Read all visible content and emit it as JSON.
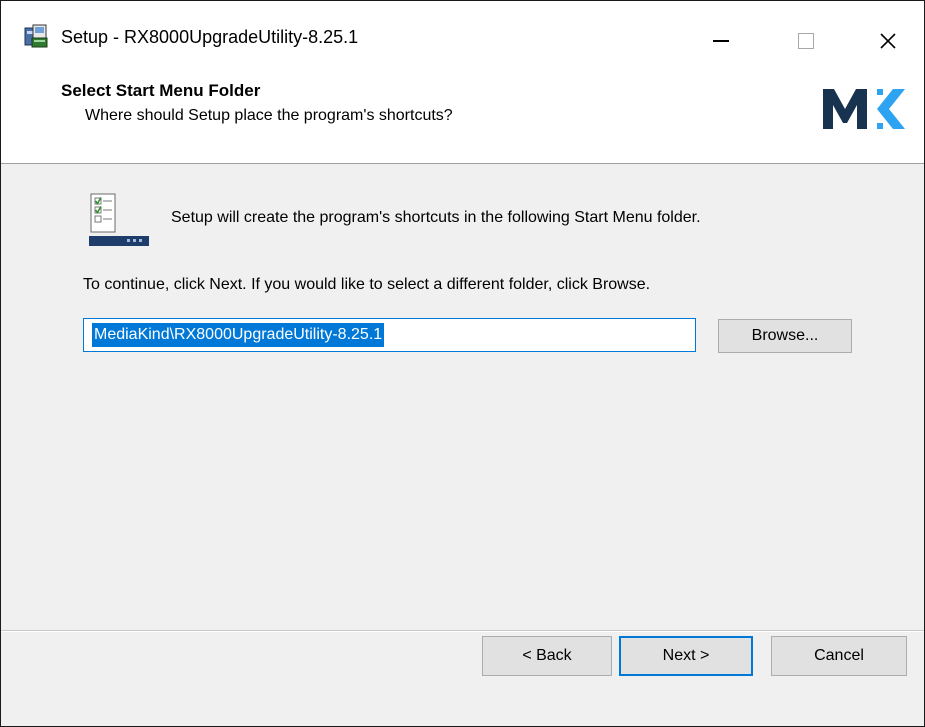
{
  "window": {
    "title": "Setup - RX8000UpgradeUtility-8.25.1",
    "controls": {
      "minimize": "minimize",
      "maximize": "maximize",
      "close": "×"
    }
  },
  "header": {
    "title": "Select Start Menu Folder",
    "subtitle": "Where should Setup place the program's shortcuts?",
    "logo_text": "MK"
  },
  "content": {
    "intro": "Setup will create the program's shortcuts in the following Start Menu folder.",
    "instruction": "To continue, click Next. If you would like to select a different folder, click Browse.",
    "folder_value": "MediaKind\\RX8000UpgradeUtility-8.25.1",
    "browse_label": "Browse..."
  },
  "footer": {
    "back_label": "< Back",
    "next_label": "Next >",
    "cancel_label": "Cancel"
  },
  "colors": {
    "accent": "#0078d7",
    "logo_dark": "#17334f",
    "logo_accent": "#2ea3f2",
    "panel_bg": "#f0f0f0"
  }
}
